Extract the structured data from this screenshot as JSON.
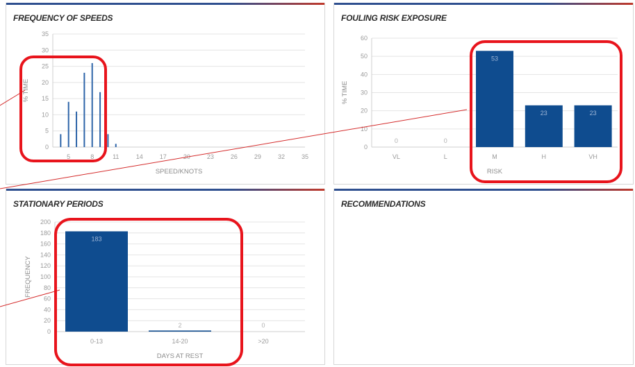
{
  "panels": {
    "speeds": {
      "title": "FREQUENCY OF SPEEDS"
    },
    "fouling": {
      "title": "FOULING RISK EXPOSURE"
    },
    "stationary": {
      "title": "STATIONARY PERIODS"
    },
    "recommendations": {
      "title": "RECOMMENDATIONS"
    }
  },
  "colors": {
    "bar": "#0f4c8f",
    "highlight": "#e8141c",
    "connector": "#d42a2a"
  },
  "chart_data": [
    {
      "type": "bar",
      "title": "FREQUENCY OF SPEEDS",
      "xlabel": "SPEED/KNOTS",
      "ylabel": "% TIME",
      "x_ticks": [
        "5",
        "8",
        "11",
        "14",
        "17",
        "20",
        "23",
        "26",
        "29",
        "32",
        "35"
      ],
      "xlim": [
        3,
        35
      ],
      "y_ticks": [
        "0",
        "5",
        "10",
        "15",
        "20",
        "25",
        "30",
        "35"
      ],
      "ylim": [
        0,
        35
      ],
      "x": [
        4,
        5,
        6,
        7,
        8,
        9,
        10,
        11
      ],
      "values": [
        4,
        14,
        11,
        23,
        26,
        17,
        4,
        1
      ],
      "grid": true
    },
    {
      "type": "bar",
      "title": "FOULING RISK EXPOSURE",
      "xlabel": "RISK",
      "ylabel": "% TIME",
      "categories": [
        "VL",
        "L",
        "M",
        "H",
        "VH"
      ],
      "values": [
        0,
        0,
        53,
        23,
        23
      ],
      "data_labels": [
        "0",
        "0",
        "53",
        "23",
        "23"
      ],
      "y_ticks": [
        "0",
        "10",
        "20",
        "30",
        "40",
        "50",
        "60"
      ],
      "ylim": [
        0,
        60
      ],
      "grid": true
    },
    {
      "type": "bar",
      "title": "STATIONARY PERIODS",
      "xlabel": "DAYS AT REST",
      "ylabel": "FREQUENCY",
      "categories": [
        "0-13",
        "14-20",
        ">20"
      ],
      "values": [
        183,
        2,
        0
      ],
      "data_labels": [
        "183",
        "2",
        "0"
      ],
      "y_ticks": [
        "0",
        "20",
        "40",
        "60",
        "80",
        "100",
        "120",
        "140",
        "160",
        "180",
        "200"
      ],
      "ylim": [
        0,
        200
      ],
      "grid": true
    }
  ]
}
